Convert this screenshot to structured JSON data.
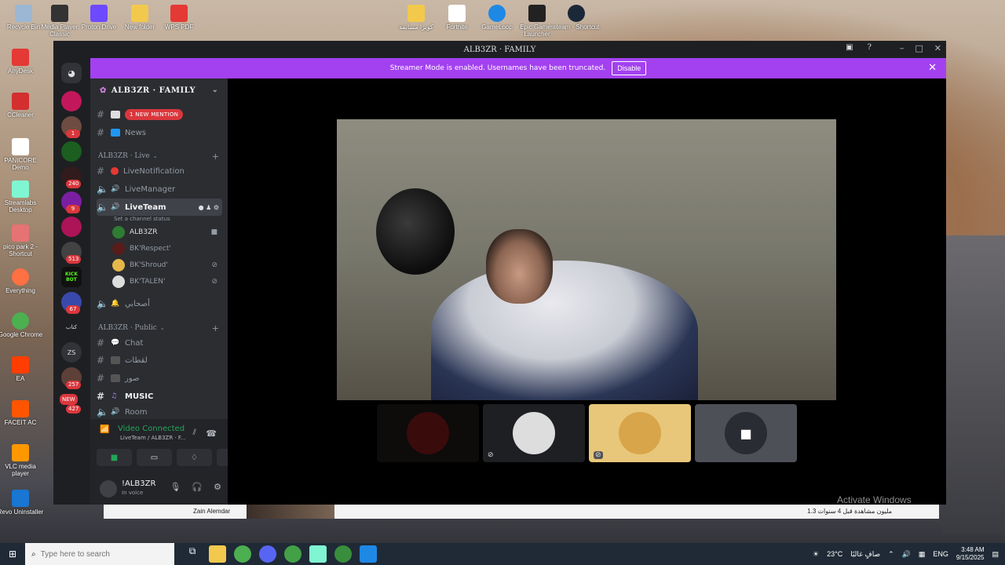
{
  "desktop": {
    "icons_left": [
      {
        "label": "Recycle Bin",
        "color": "#9bb7d4"
      },
      {
        "label": "Media Player Classic",
        "color": "#333"
      },
      {
        "label": "Proton Drive",
        "color": "#6d4aff"
      },
      {
        "label": "New folder",
        "color": "#f2c94c"
      },
      {
        "label": "WPS PDF",
        "color": "#e53935"
      }
    ],
    "icons_top": [
      {
        "label": "كويزا مسابقة",
        "color": "#f2c94c"
      },
      {
        "label": "Fortnite",
        "color": "#ffffff"
      },
      {
        "label": "GameLoop",
        "color": "#1e88e5"
      },
      {
        "label": "Epic Games Launcher",
        "color": "#222"
      },
      {
        "label": "steam - Shortcut",
        "color": "#1b2838"
      }
    ],
    "icons_col": [
      {
        "label": "AnyDesk",
        "color": "#e53935"
      },
      {
        "label": "CCleaner",
        "color": "#d32f2f"
      },
      {
        "label": "PANICORE Demo",
        "color": "#ffffff"
      },
      {
        "label": "Streamlabs Desktop",
        "color": "#80f5d2"
      },
      {
        "label": "pico park 2 - Shortcut",
        "color": "#e57373"
      },
      {
        "label": "Everything",
        "color": "#ff7043"
      },
      {
        "label": "Google Chrome",
        "color": "#4caf50"
      },
      {
        "label": "EA",
        "color": "#ff3d00"
      },
      {
        "label": "FACEIT AC",
        "color": "#ff5500"
      },
      {
        "label": "VLC media player",
        "color": "#ff9800"
      },
      {
        "label": "Revo Uninstaller",
        "color": "#1976d2"
      }
    ],
    "watermark": "Activate Windows"
  },
  "window": {
    "title": "ALB3ZR · FAMILY"
  },
  "banner": {
    "text": "Streamer Mode is enabled. Usernames have been truncated.",
    "disable_label": "Disable"
  },
  "guilds": {
    "badges": [
      "1",
      "240",
      "9",
      "513",
      "67",
      "257",
      "427"
    ],
    "kick_label": "KICK BOT",
    "zs_label": "ZS",
    "kitab_label": "كتاب",
    "new_label": "NEW"
  },
  "sidebar": {
    "server_name": "ALB3ZR · FAMILY",
    "mention_pill": "1 NEW MENTION",
    "news_channel": "News",
    "category_live": "ALB3ZR · Live",
    "live_notification": "LiveNotification",
    "live_manager": "LiveManager",
    "live_team": "LiveTeam",
    "set_status": "Set a channel status",
    "voice_users": [
      "ALB3ZR",
      "BK'Respect'",
      "BK'Shroud'",
      "BK'TALEN'"
    ],
    "voice_extra": "أصحابي",
    "category_public": "ALB3ZR · Public",
    "chat": "Chat",
    "ch_lqtat": "لقطات",
    "ch_sowar": "صور",
    "music": "MUSIC",
    "room": "Room"
  },
  "voice_panel": {
    "title": "Video Connected",
    "subtitle": "LiveTeam / ALB3ZR · F..."
  },
  "user_panel": {
    "name": "!ALB3ZR",
    "status": "In voice"
  },
  "browser": {
    "channel": "Zain Alemdar",
    "stats": "1.3 مليون مشاهدة قبل 4 سنوات"
  },
  "taskbar": {
    "search_placeholder": "Type here to search",
    "weather": "23°C",
    "weather_desc": "صافٍ غالبًا",
    "lang": "ENG",
    "time": "3:48 AM",
    "date": "9/15/2025"
  }
}
